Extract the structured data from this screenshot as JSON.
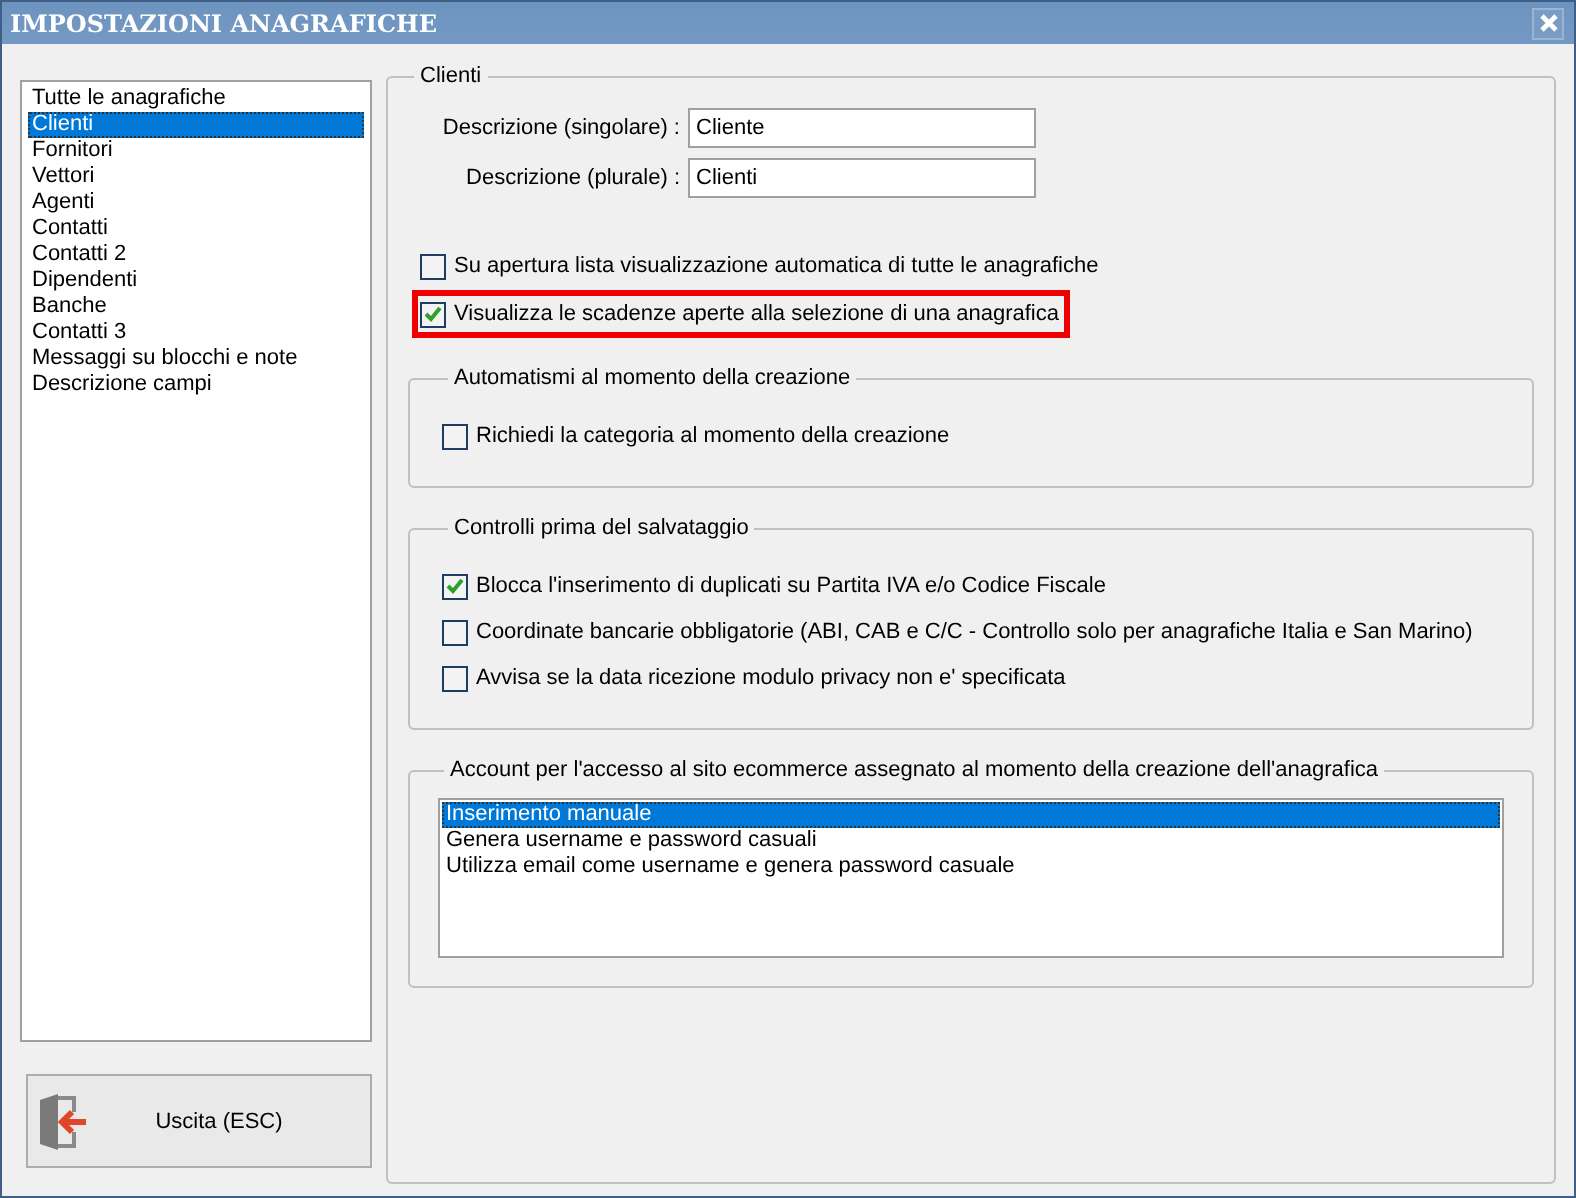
{
  "window": {
    "title": "IMPOSTAZIONI ANAGRAFICHE"
  },
  "sidebar": {
    "items": [
      {
        "label": "Tutte le anagrafiche",
        "selected": false
      },
      {
        "label": "Clienti",
        "selected": true
      },
      {
        "label": "Fornitori",
        "selected": false
      },
      {
        "label": "Vettori",
        "selected": false
      },
      {
        "label": "Agenti",
        "selected": false
      },
      {
        "label": "Contatti",
        "selected": false
      },
      {
        "label": "Contatti 2",
        "selected": false
      },
      {
        "label": "Dipendenti",
        "selected": false
      },
      {
        "label": "Banche",
        "selected": false
      },
      {
        "label": "Contatti 3",
        "selected": false
      },
      {
        "label": "Messaggi su blocchi e note",
        "selected": false
      },
      {
        "label": "Descrizione campi",
        "selected": false
      }
    ]
  },
  "exit_button": {
    "label": "Uscita (ESC)"
  },
  "panel": {
    "title": "Clienti",
    "fields": [
      {
        "label": "Descrizione (singolare) :",
        "value": "Cliente"
      },
      {
        "label": "Descrizione (plurale) :",
        "value": "Clienti"
      }
    ],
    "options": [
      {
        "label": "Su apertura lista visualizzazione automatica di tutte le anagrafiche",
        "checked": false,
        "highlighted": false
      },
      {
        "label": "Visualizza le scadenze aperte alla selezione di una anagrafica",
        "checked": true,
        "highlighted": true
      }
    ],
    "groups": [
      {
        "title": "Automatismi al momento della creazione",
        "options": [
          {
            "label": "Richiedi la categoria al momento della creazione",
            "checked": false
          }
        ]
      },
      {
        "title": "Controlli prima del salvataggio",
        "options": [
          {
            "label": "Blocca l'inserimento di duplicati su Partita IVA e/o Codice Fiscale",
            "checked": true
          },
          {
            "label": "Coordinate bancarie obbligatorie (ABI, CAB e C/C - Controllo solo per anagrafiche Italia e San Marino)",
            "checked": false
          },
          {
            "label": "Avvisa se la data ricezione modulo privacy non e' specificata",
            "checked": false
          }
        ]
      }
    ],
    "account": {
      "title": "Account per l'accesso al sito ecommerce assegnato al momento della creazione dell'anagrafica",
      "items": [
        {
          "label": "Inserimento manuale",
          "selected": true
        },
        {
          "label": "Genera username e password casuali",
          "selected": false
        },
        {
          "label": "Utilizza email come username e genera password casuale",
          "selected": false
        }
      ]
    }
  }
}
